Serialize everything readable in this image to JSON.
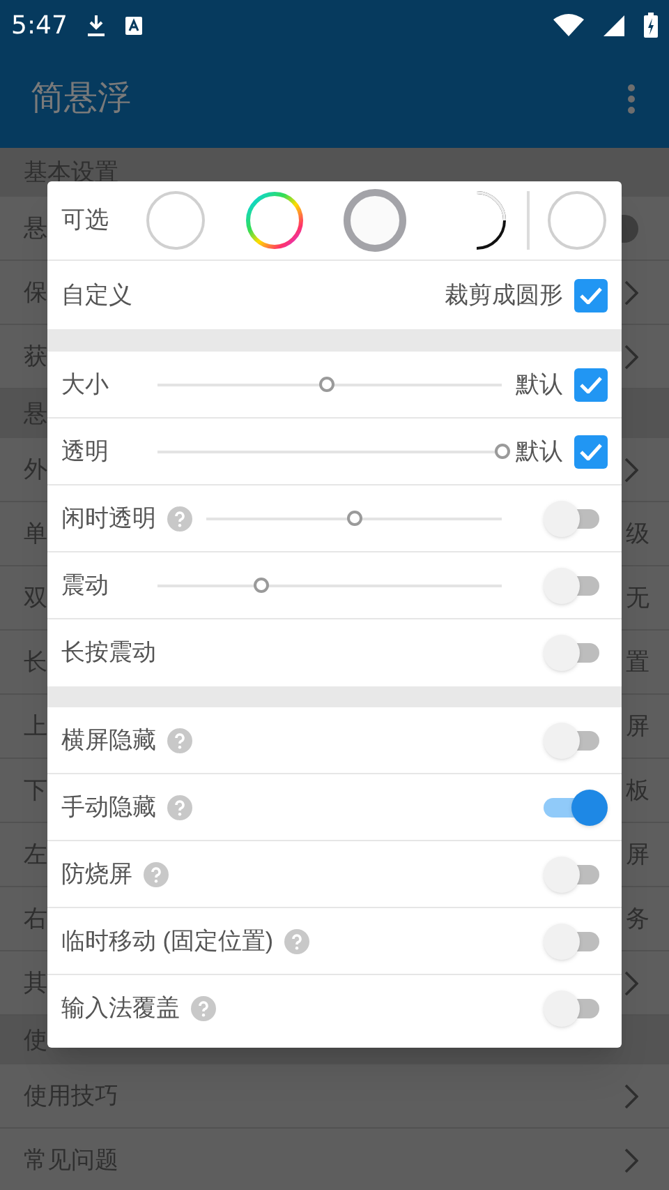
{
  "status_bar": {
    "time": "5:47"
  },
  "app_bar": {
    "title": "简悬浮"
  },
  "background_list": [
    {
      "kind": "header",
      "left": "基本设置"
    },
    {
      "kind": "row",
      "left": "悬",
      "toggle_on": false
    },
    {
      "kind": "row",
      "left": "保",
      "chevron": true
    },
    {
      "kind": "row",
      "left": "获",
      "chevron": true
    },
    {
      "kind": "header",
      "left": "悬"
    },
    {
      "kind": "row",
      "left": "外",
      "chevron": true
    },
    {
      "kind": "row",
      "left": "单",
      "right": "级"
    },
    {
      "kind": "row",
      "left": "双",
      "right": "无"
    },
    {
      "kind": "row",
      "left": "长",
      "right": "置"
    },
    {
      "kind": "row",
      "left": "上",
      "right": "屏"
    },
    {
      "kind": "row",
      "left": "下",
      "right": "板"
    },
    {
      "kind": "row",
      "left": "左",
      "right": "屏"
    },
    {
      "kind": "row",
      "left": "右",
      "right": "务"
    },
    {
      "kind": "row",
      "left": "其",
      "chevron": true
    },
    {
      "kind": "header",
      "left": "使"
    },
    {
      "kind": "row",
      "left": "使用技巧",
      "chevron": true
    },
    {
      "kind": "row",
      "left": "常见问题",
      "chevron": true
    }
  ],
  "dialog": {
    "styles_label": "可选",
    "styles": [
      {
        "kind": "plain"
      },
      {
        "kind": "rainbow"
      },
      {
        "kind": "ring"
      },
      {
        "kind": "crescent"
      }
    ],
    "custom_style": {
      "kind": "plain"
    },
    "custom": {
      "label": "自定义",
      "option": "裁剪成圆形",
      "checked": true
    },
    "groups": [
      [
        {
          "kind": "slider_check",
          "label": "大小",
          "level": 0.49,
          "option": "默认",
          "checked": true
        },
        {
          "kind": "slider_check",
          "label": "透明",
          "level": 1,
          "option": "默认",
          "checked": true
        },
        {
          "kind": "slider_toggle",
          "label": "闲时透明",
          "help": true,
          "level": 0.5,
          "on": false
        },
        {
          "kind": "slider_toggle",
          "label": "震动",
          "level": 0.3,
          "on": false
        },
        {
          "kind": "toggle",
          "label": "长按震动",
          "on": false
        }
      ],
      [
        {
          "kind": "toggle",
          "label": "横屏隐藏",
          "help": true,
          "on": false
        },
        {
          "kind": "toggle",
          "label": "手动隐藏",
          "help": true,
          "on": true
        },
        {
          "kind": "toggle",
          "label": "防烧屏",
          "help": true,
          "on": false
        },
        {
          "kind": "toggle",
          "label": "临时移动 (固定位置)",
          "help": true,
          "on": false
        },
        {
          "kind": "toggle",
          "label": "输入法覆盖",
          "help": true,
          "on": false
        }
      ]
    ]
  }
}
